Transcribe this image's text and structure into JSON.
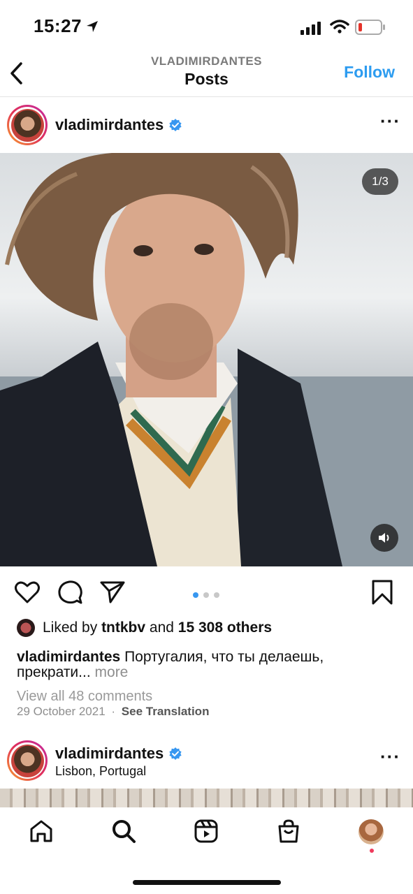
{
  "status_bar": {
    "time": "15:27"
  },
  "header": {
    "username": "VLADIMIRDANTES",
    "title": "Posts",
    "follow_label": "Follow"
  },
  "post": {
    "username": "vladimirdantes",
    "image_counter": "1/3",
    "liked_by_prefix": "Liked by",
    "liked_by_user": "tntkbv",
    "liked_by_and": "and",
    "liked_by_others": "15 308 others",
    "caption_user": "vladimirdantes",
    "caption_text_1": "Португалия, что ты делаешь,",
    "caption_text_2": "прекрати...",
    "caption_more": "more",
    "view_comments": "View all 48 comments",
    "date": "29 October 2021",
    "separator": "·",
    "see_translation": "See Translation",
    "carousel": {
      "total": 3,
      "active": 1
    }
  },
  "post2": {
    "username": "vladimirdantes",
    "location": "Lisbon, Portugal"
  },
  "colors": {
    "accent": "#2d9cf0",
    "verified": "#3897f0",
    "muted": "#8e8e8e"
  }
}
